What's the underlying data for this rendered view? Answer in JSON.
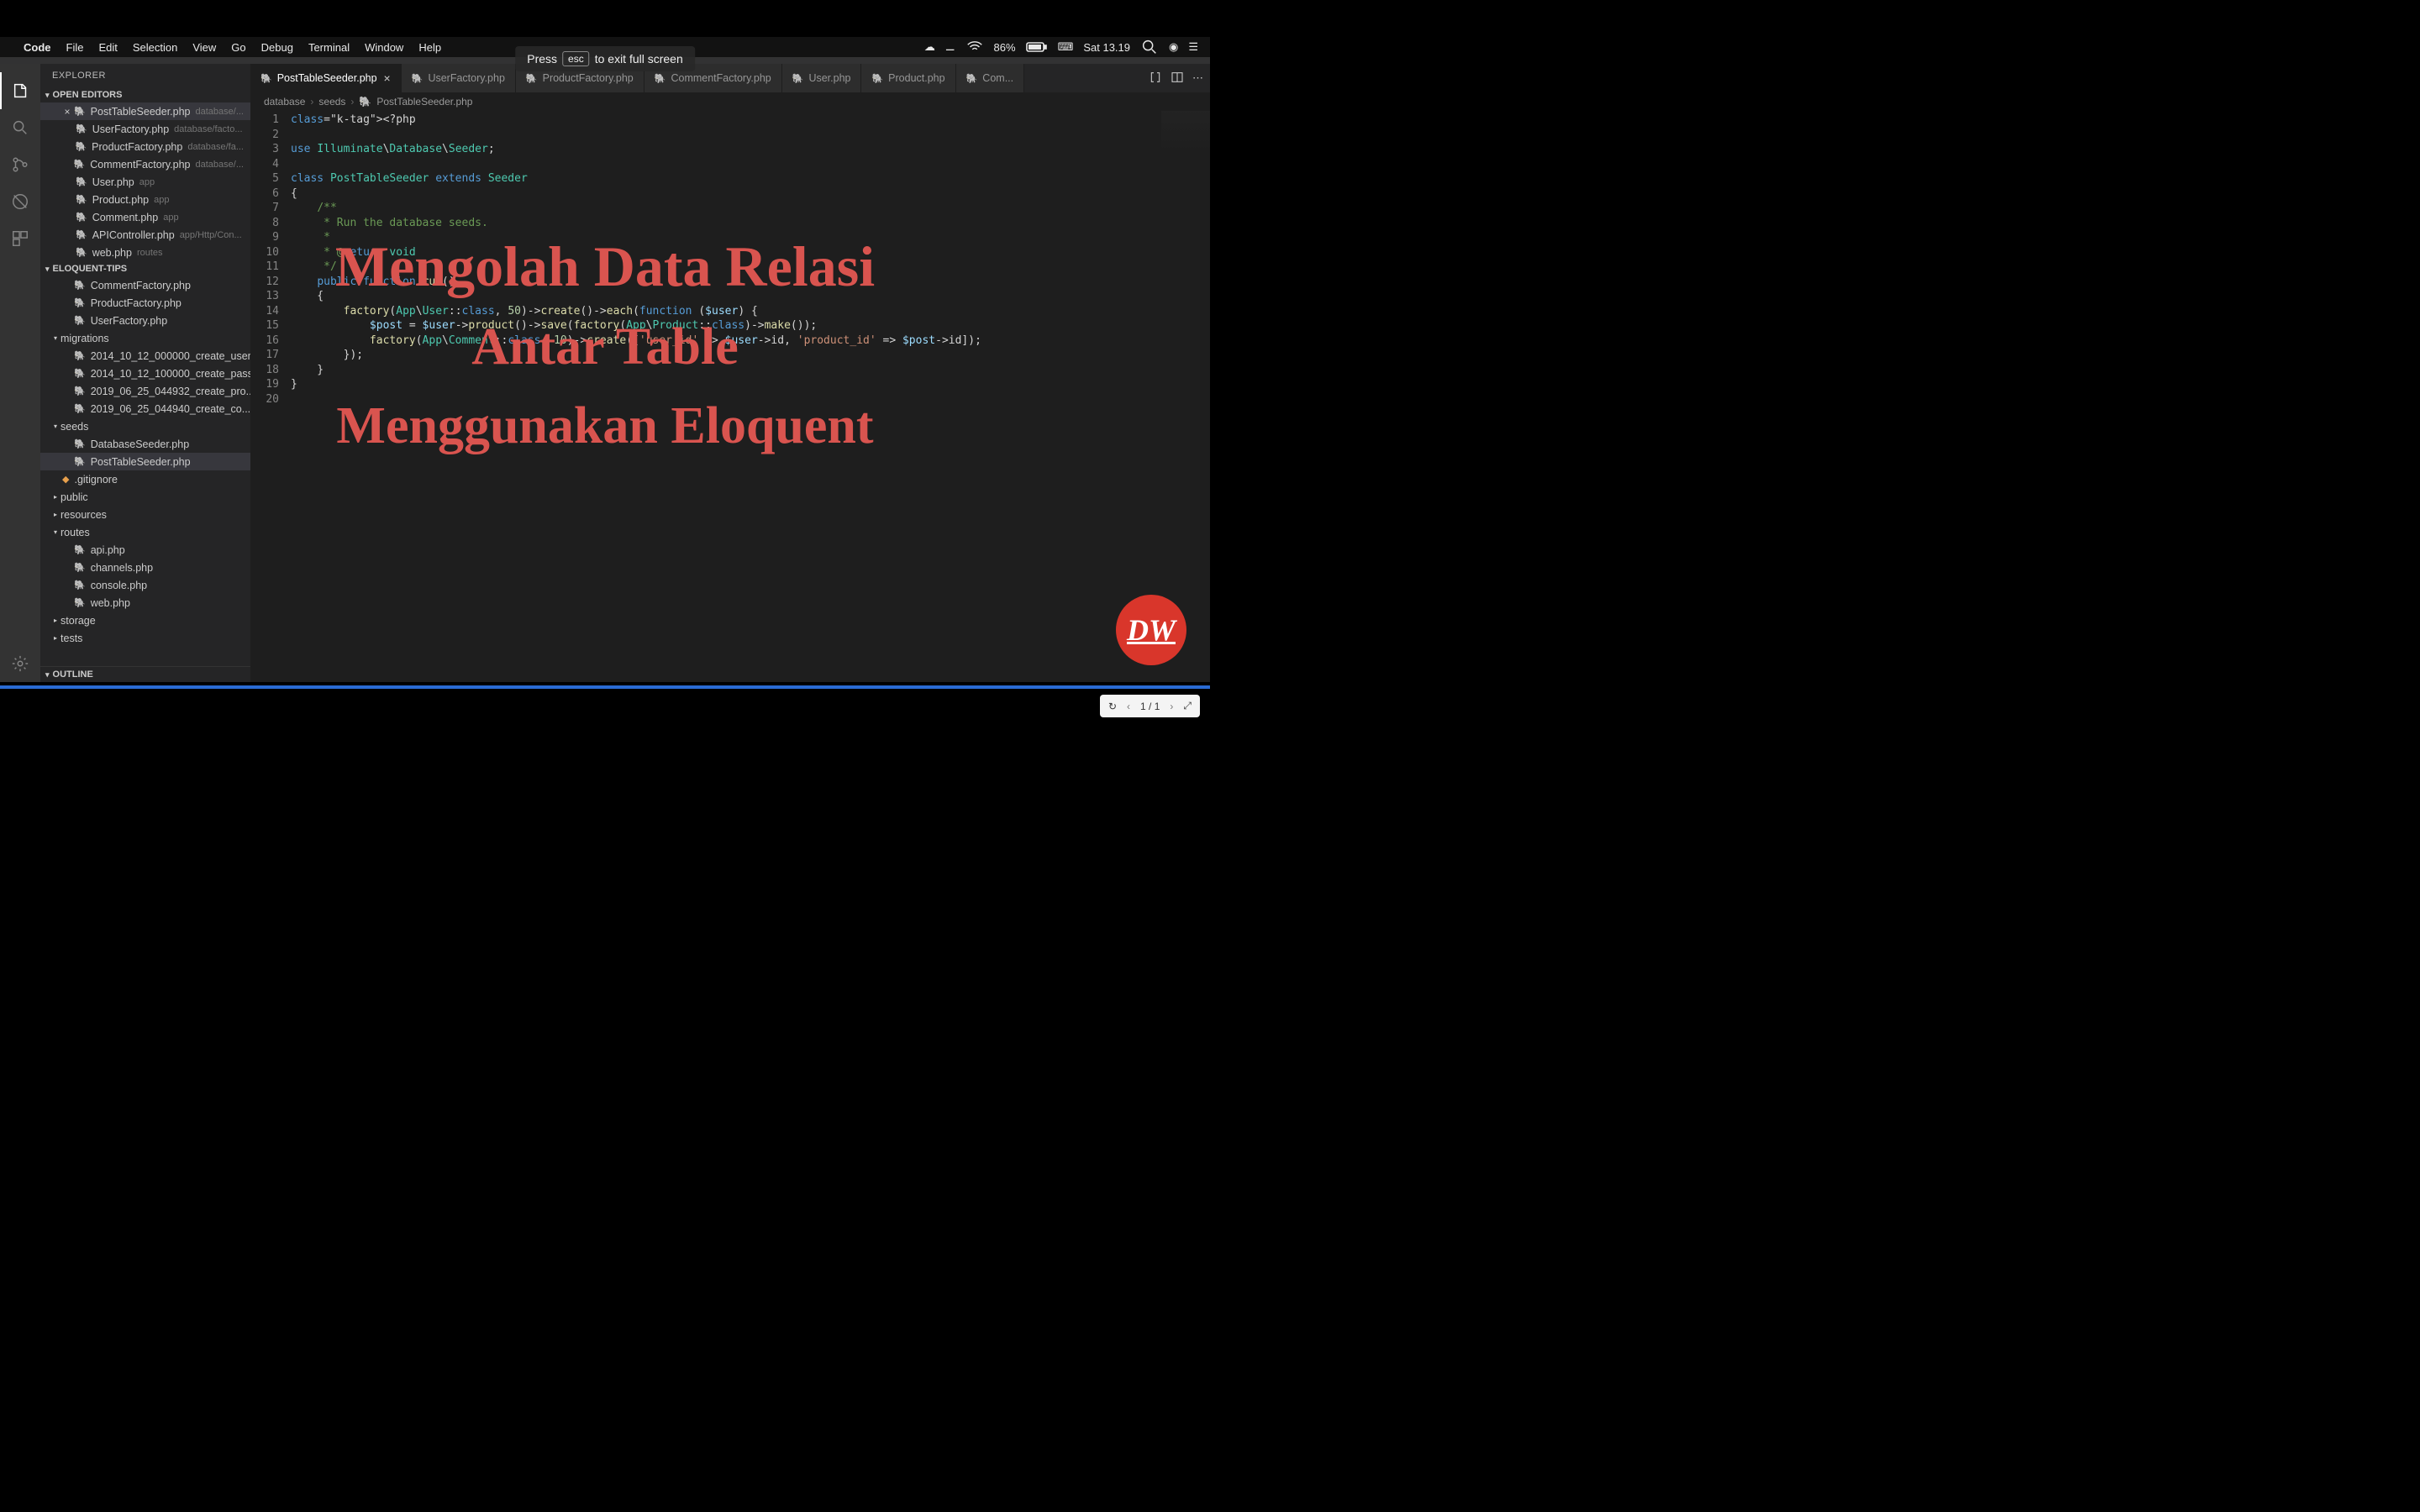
{
  "macos": {
    "app": "Code",
    "menus": [
      "File",
      "Edit",
      "Selection",
      "View",
      "Go",
      "Debug",
      "Terminal",
      "Window",
      "Help"
    ],
    "battery": "86%",
    "time": "Sat 13.19"
  },
  "esc_notice": {
    "pre": "Press",
    "key": "esc",
    "post": "to exit full screen"
  },
  "sidebar": {
    "title": "EXPLORER",
    "open_editors_label": "OPEN EDITORS",
    "project_label": "ELOQUENT-TIPS",
    "outline_label": "OUTLINE",
    "open_editors": [
      {
        "name": "PostTableSeeder.php",
        "hint": "database/...",
        "close": true
      },
      {
        "name": "UserFactory.php",
        "hint": "database/facto..."
      },
      {
        "name": "ProductFactory.php",
        "hint": "database/fa..."
      },
      {
        "name": "CommentFactory.php",
        "hint": "database/..."
      },
      {
        "name": "User.php",
        "hint": "app"
      },
      {
        "name": "Product.php",
        "hint": "app"
      },
      {
        "name": "Comment.php",
        "hint": "app"
      },
      {
        "name": "APIController.php",
        "hint": "app/Http/Con..."
      },
      {
        "name": "web.php",
        "hint": "routes"
      }
    ],
    "tree": [
      {
        "name": "CommentFactory.php",
        "type": "file",
        "indent": 1
      },
      {
        "name": "ProductFactory.php",
        "type": "file",
        "indent": 1
      },
      {
        "name": "UserFactory.php",
        "type": "file",
        "indent": 1
      },
      {
        "name": "migrations",
        "type": "folder",
        "indent": 0
      },
      {
        "name": "2014_10_12_000000_create_user...",
        "type": "file",
        "indent": 1
      },
      {
        "name": "2014_10_12_100000_create_pass...",
        "type": "file",
        "indent": 1
      },
      {
        "name": "2019_06_25_044932_create_pro...",
        "type": "file",
        "indent": 1
      },
      {
        "name": "2019_06_25_044940_create_co...",
        "type": "file",
        "indent": 1
      },
      {
        "name": "seeds",
        "type": "folder",
        "indent": 0
      },
      {
        "name": "DatabaseSeeder.php",
        "type": "file",
        "indent": 1
      },
      {
        "name": "PostTableSeeder.php",
        "type": "file",
        "indent": 1,
        "selected": true
      },
      {
        "name": ".gitignore",
        "type": "file",
        "indent": 0,
        "git": true
      },
      {
        "name": "public",
        "type": "folder",
        "indent": 0,
        "collapsed": true
      },
      {
        "name": "resources",
        "type": "folder",
        "indent": 0,
        "collapsed": true
      },
      {
        "name": "routes",
        "type": "folder",
        "indent": 0
      },
      {
        "name": "api.php",
        "type": "file",
        "indent": 1
      },
      {
        "name": "channels.php",
        "type": "file",
        "indent": 1
      },
      {
        "name": "console.php",
        "type": "file",
        "indent": 1
      },
      {
        "name": "web.php",
        "type": "file",
        "indent": 1
      },
      {
        "name": "storage",
        "type": "folder",
        "indent": 0,
        "collapsed": true
      },
      {
        "name": "tests",
        "type": "folder",
        "indent": 0,
        "collapsed": true
      }
    ]
  },
  "tabs": [
    {
      "label": "PostTableSeeder.php",
      "active": true
    },
    {
      "label": "UserFactory.php"
    },
    {
      "label": "ProductFactory.php"
    },
    {
      "label": "CommentFactory.php"
    },
    {
      "label": "User.php"
    },
    {
      "label": "Product.php"
    },
    {
      "label": "Com..."
    }
  ],
  "breadcrumb": [
    "database",
    "seeds",
    "PostTableSeeder.php"
  ],
  "code_lines": [
    "<?php",
    "",
    "use Illuminate\\Database\\Seeder;",
    "",
    "class PostTableSeeder extends Seeder",
    "{",
    "    /**",
    "     * Run the database seeds.",
    "     *",
    "     * @return void",
    "     */",
    "    public function run()",
    "    {",
    "        factory(App\\User::class, 50)->create()->each(function ($user) {",
    "            $post = $user->product()->save(factory(App\\Product::class)->make());",
    "            factory(App\\Comment::class, 10)->create(['user_id' => $user->id, 'product_id' => $post->id]);",
    "        });",
    "    }",
    "}",
    ""
  ],
  "overlay": {
    "l1": "Mengolah Data Relasi",
    "l2": "Antar Table",
    "l3": "Menggunakan Eloquent"
  },
  "badge": "DW",
  "viewer": {
    "page": "1 / 1"
  }
}
